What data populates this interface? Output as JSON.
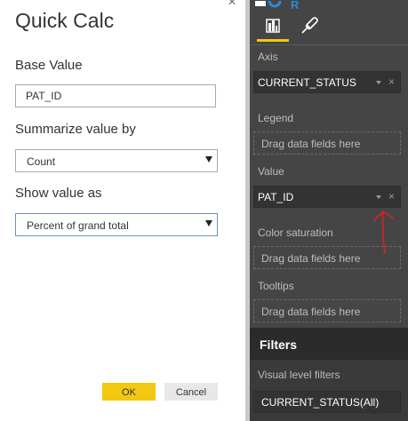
{
  "dialog": {
    "title": "Quick Calc",
    "close_glyph": "×",
    "base_value": {
      "label": "Base Value",
      "value": "PAT_ID"
    },
    "summarize": {
      "label": "Summarize value by",
      "selected": "Count"
    },
    "show_value": {
      "label": "Show value as",
      "selected": "Percent of grand total"
    },
    "ok_label": "OK",
    "cancel_label": "Cancel"
  },
  "pane": {
    "tabs": [
      {
        "name": "fields",
        "icon": "bar-chart-icon",
        "active": true
      },
      {
        "name": "format",
        "icon": "paint-roller-icon",
        "active": false
      }
    ],
    "wells": {
      "axis": {
        "label": "Axis",
        "field": "CURRENT_STATUS"
      },
      "legend": {
        "label": "Legend",
        "placeholder": "Drag data fields here"
      },
      "value": {
        "label": "Value",
        "field": "PAT_ID"
      },
      "color_saturation": {
        "label": "Color saturation",
        "placeholder": "Drag data fields here"
      },
      "tooltips": {
        "label": "Tooltips",
        "placeholder": "Drag data fields here"
      }
    },
    "remove_glyph": "×",
    "filters": {
      "title": "Filters",
      "visual_level_label": "Visual level filters",
      "items": [
        "CURRENT_STATUS(All)"
      ]
    }
  },
  "colors": {
    "accent_yellow": "#f2c811",
    "pane_bg": "#454545",
    "annotation_red": "#c0282d"
  }
}
